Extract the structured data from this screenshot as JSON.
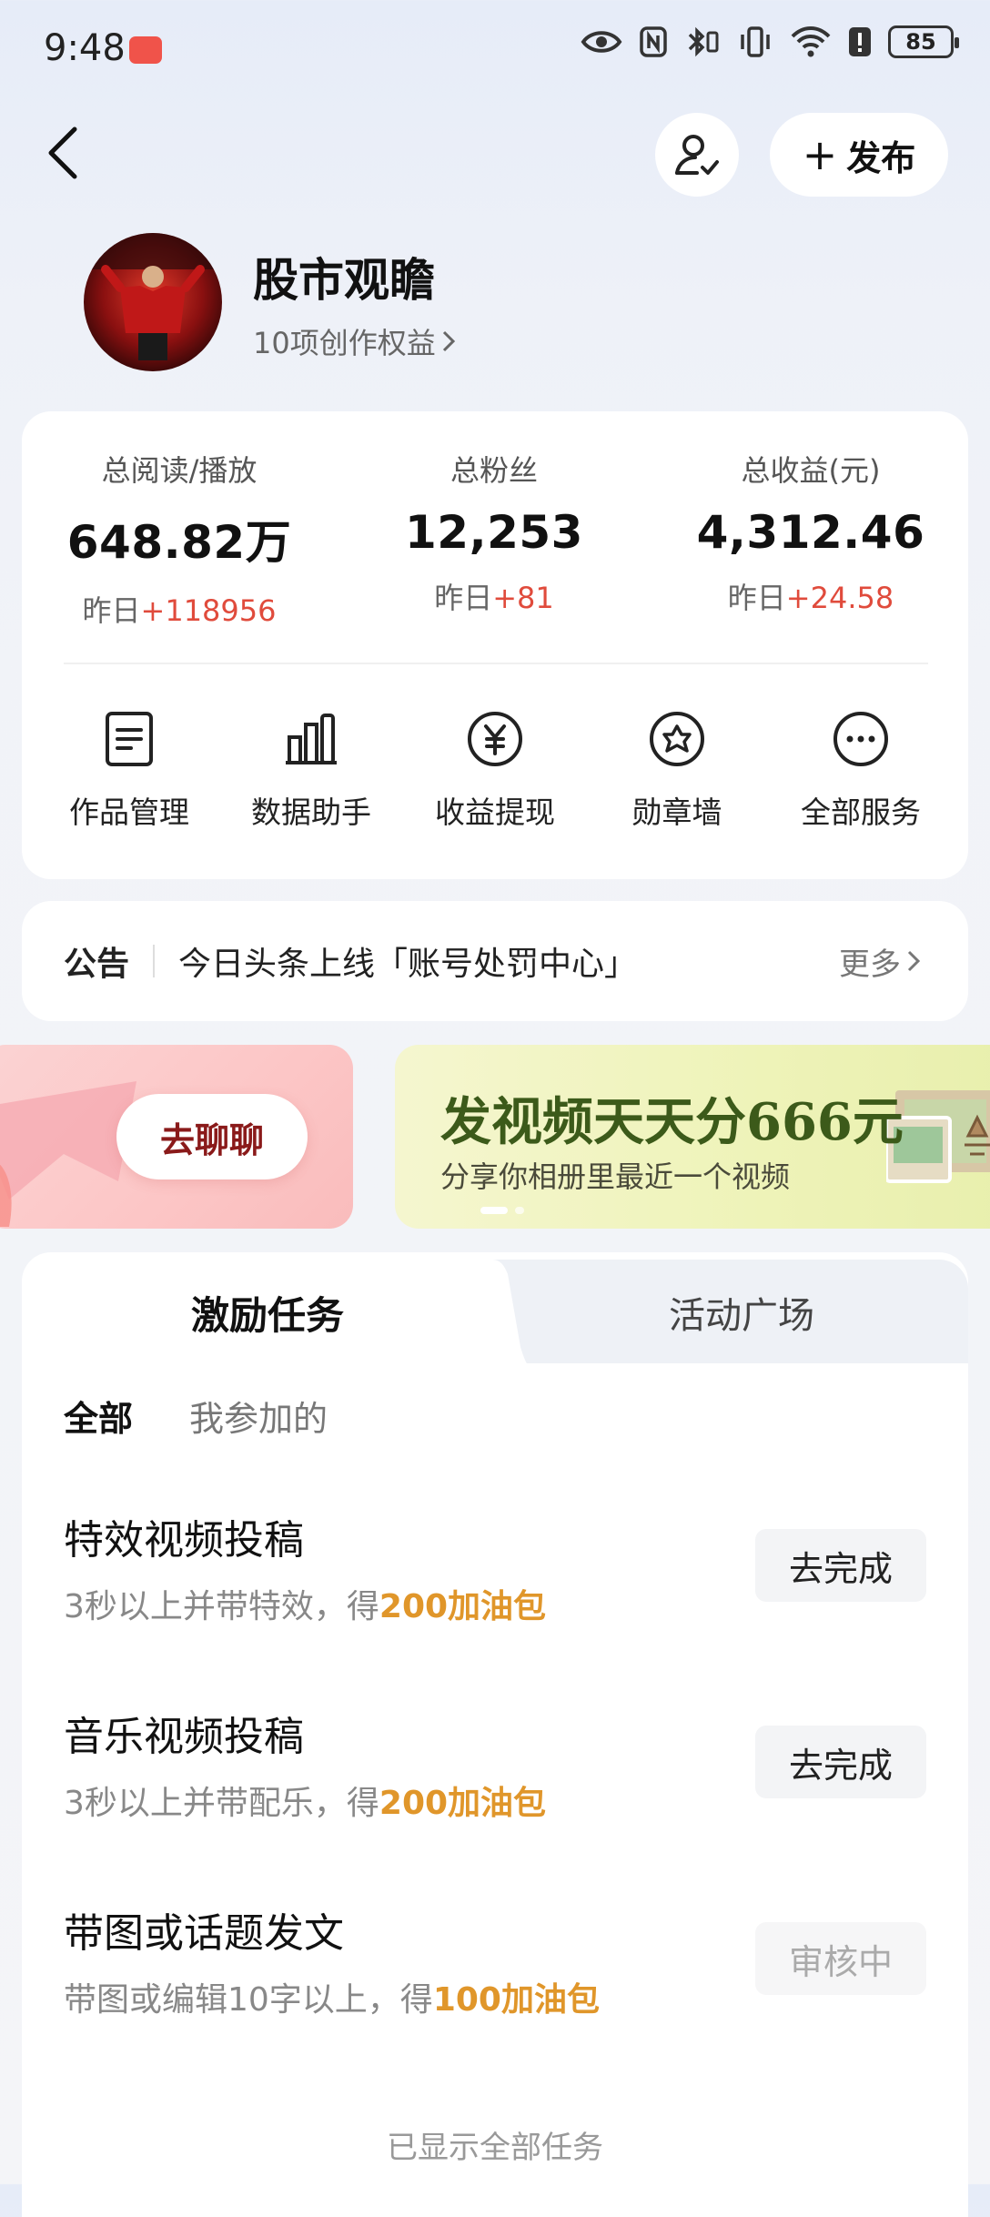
{
  "status_bar": {
    "time": "9:48",
    "battery": "85",
    "icons": [
      "huawei-badge-icon",
      "eye-icon",
      "nfc-icon",
      "bluetooth-icon",
      "vibrate-icon",
      "wifi-icon",
      "alert-icon",
      "battery-icon"
    ]
  },
  "header": {
    "publish_label": "发布"
  },
  "profile": {
    "name": "股市观瞻",
    "rights": "10项创作权益"
  },
  "stats": [
    {
      "label": "总阅读/播放",
      "value": "648.82万",
      "delta_prefix": "昨日",
      "delta": "+118956"
    },
    {
      "label": "总粉丝",
      "value": "12,253",
      "delta_prefix": "昨日",
      "delta": "+81"
    },
    {
      "label": "总收益(元)",
      "value": "4,312.46",
      "delta_prefix": "昨日",
      "delta": "+24.58"
    }
  ],
  "services": [
    {
      "label": "作品管理",
      "icon": "document-icon"
    },
    {
      "label": "数据助手",
      "icon": "bar-chart-icon"
    },
    {
      "label": "收益提现",
      "icon": "yen-icon"
    },
    {
      "label": "勋章墙",
      "icon": "medal-icon"
    },
    {
      "label": "全部服务",
      "icon": "more-icon"
    }
  ],
  "notice": {
    "tag": "公告",
    "text": "今日头条上线「账号处罚中心」",
    "more": "更多"
  },
  "banners": {
    "chat_button": "去聊聊",
    "promo_title": "发视频天天分666元",
    "promo_subtitle": "分享你相册里最近一个视频"
  },
  "tasks": {
    "tabs": [
      "激励任务",
      "活动广场"
    ],
    "filters": [
      "全部",
      "我参加的"
    ],
    "items": [
      {
        "title": "特效视频投稿",
        "desc_prefix": "3秒以上并带特效，得",
        "reward": "200加油包",
        "button": "去完成"
      },
      {
        "title": "音乐视频投稿",
        "desc_prefix": "3秒以上并带配乐，得",
        "reward": "200加油包",
        "button": "去完成"
      },
      {
        "title": "带图或话题发文",
        "desc_prefix": "带图或编辑10字以上，得",
        "reward": "100加油包",
        "button": "审核中"
      }
    ],
    "footer": "已显示全部任务"
  },
  "colors": {
    "accent_red": "#e04b3c",
    "reward_orange": "#e0962a",
    "promo_green": "#3c5a1a"
  }
}
